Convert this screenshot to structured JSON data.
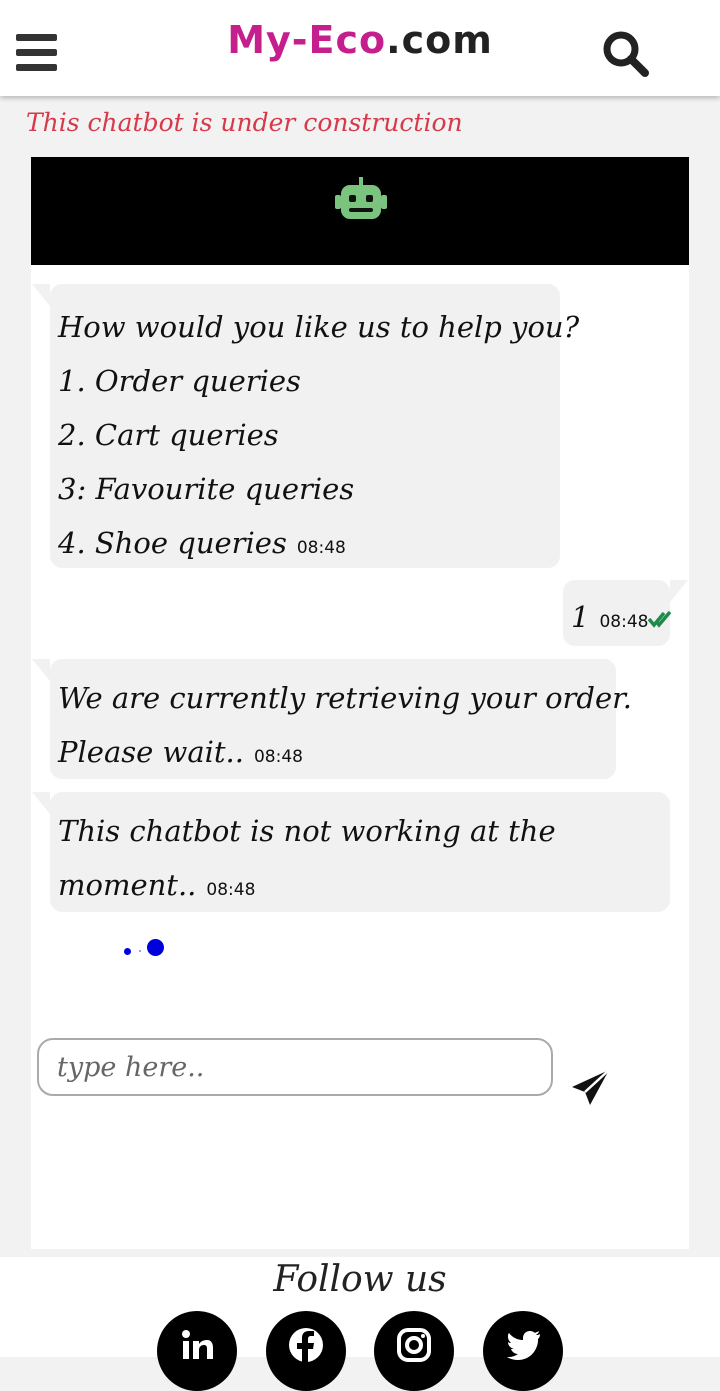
{
  "header": {
    "logo_brand": "My-Eco",
    "logo_tld": ".com",
    "menu_icon": "hamburger-menu-icon",
    "search_icon": "search-icon"
  },
  "notice": "This chatbot is under construction",
  "chat": {
    "header_icon": "robot-icon",
    "messages": [
      {
        "sender": "bot",
        "lines": [
          "How would you like us to help you?",
          "1. Order queries",
          "2. Cart queries",
          "3: Favourite queries",
          "4. Shoe queries"
        ],
        "time": "08:48"
      },
      {
        "sender": "user",
        "lines": [
          "1"
        ],
        "time": "08:48",
        "status_icon": "double-check-icon"
      },
      {
        "sender": "bot",
        "lines": [
          "We are currently retrieving your order.",
          "Please wait.."
        ],
        "time": "08:48"
      },
      {
        "sender": "bot",
        "lines": [
          "This chatbot is not working at the",
          "moment.."
        ],
        "time": "08:48"
      }
    ],
    "input_placeholder": "type here..",
    "send_icon": "send-paper-plane-icon"
  },
  "footer": {
    "follow_label": "Follow us",
    "social_icons": [
      "linkedin-icon",
      "facebook-icon",
      "instagram-icon",
      "twitter-icon"
    ]
  },
  "colors": {
    "brand": "#c51e8d",
    "notice": "#d63a4a",
    "bubble": "#f1f1f1",
    "check": "#1f8a4c",
    "typing_dots": "#0000dd",
    "robot": "#7bc47f"
  }
}
